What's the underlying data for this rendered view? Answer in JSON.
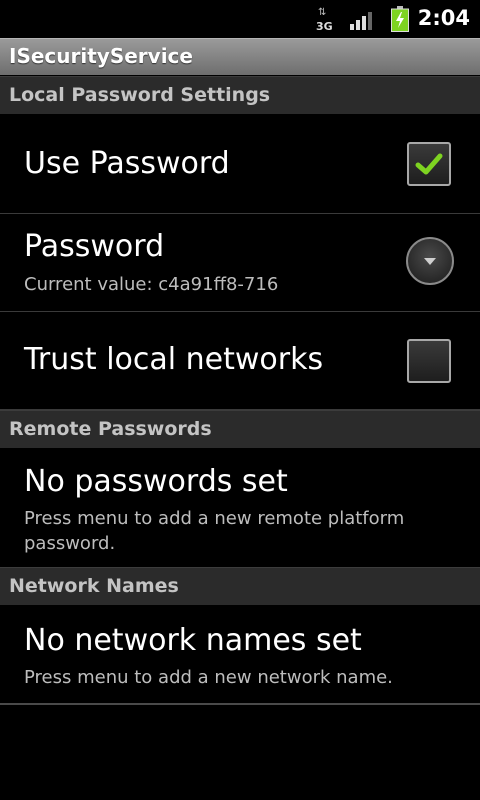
{
  "status_bar": {
    "network_type": "3G",
    "time": "2:04"
  },
  "app": {
    "title": "ISecurityService"
  },
  "sections": [
    {
      "header": "Local Password Settings",
      "items": [
        {
          "title": "Use Password",
          "widget": "checkbox",
          "checked": true
        },
        {
          "title": "Password",
          "summary": "Current value: c4a91ff8-716",
          "widget": "dropdown"
        },
        {
          "title": "Trust local networks",
          "widget": "checkbox",
          "checked": false
        }
      ]
    },
    {
      "header": "Remote Passwords",
      "items": [
        {
          "title": "No passwords set",
          "summary": "Press menu to add a new remote platform password."
        }
      ]
    },
    {
      "header": "Network Names",
      "items": [
        {
          "title": "No network names set",
          "summary": "Press menu to add a new network name."
        }
      ]
    }
  ],
  "colors": {
    "check_accent": "#7ed321",
    "battery_accent": "#7ed321"
  },
  "icons": [
    "data-3g-icon",
    "signal-strength-icon",
    "battery-charging-icon",
    "checkmark-icon",
    "dropdown-arrow-icon"
  ]
}
